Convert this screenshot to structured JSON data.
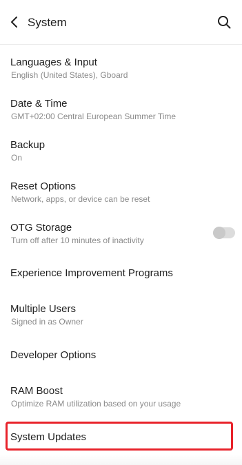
{
  "header": {
    "title": "System",
    "back_icon": "chevron-left-icon",
    "search_icon": "search-icon"
  },
  "items": [
    {
      "title": "Languages & Input",
      "subtitle": "English (United States), Gboard"
    },
    {
      "title": "Date & Time",
      "subtitle": "GMT+02:00 Central European Summer Time"
    },
    {
      "title": "Backup",
      "subtitle": "On"
    },
    {
      "title": "Reset Options",
      "subtitle": "Network, apps, or device can be reset"
    },
    {
      "title": "OTG Storage",
      "subtitle": "Turn off after 10 minutes of inactivity",
      "toggle": "off"
    },
    {
      "title": "Experience Improvement Programs"
    },
    {
      "title": "Multiple Users",
      "subtitle": "Signed in as Owner"
    },
    {
      "title": "Developer Options"
    },
    {
      "title": "RAM Boost",
      "subtitle": "Optimize RAM utilization based on your usage"
    },
    {
      "title": "System Updates",
      "highlighted": true
    }
  ],
  "colors": {
    "highlight": "#e8222a",
    "text_primary": "#1f1f1f",
    "text_secondary": "#8a8a8a"
  }
}
